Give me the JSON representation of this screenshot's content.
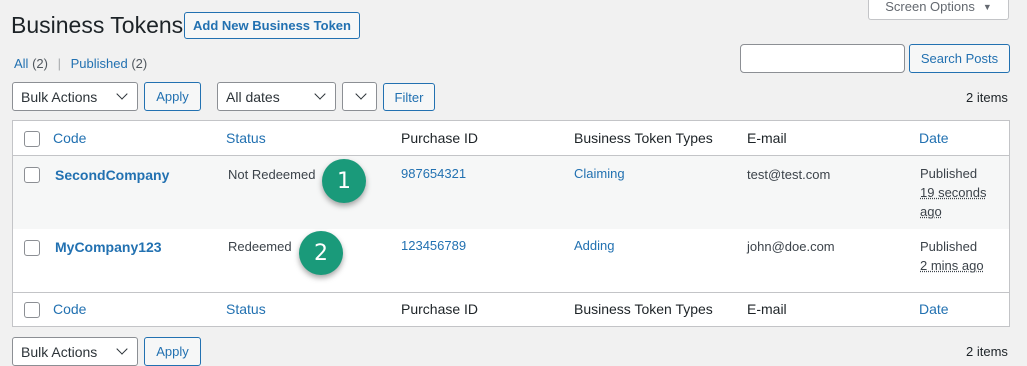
{
  "header": {
    "title": "Business Tokens",
    "add_new_label": "Add New Business Token",
    "screen_options_label": "Screen Options"
  },
  "filters": {
    "all_label": "All",
    "all_count": "(2)",
    "published_label": "Published",
    "published_count": "(2)"
  },
  "search": {
    "value": "",
    "button_label": "Search Posts"
  },
  "tablenav_top": {
    "bulk_actions": "Bulk Actions",
    "apply_label": "Apply",
    "dates": "All dates",
    "category": "",
    "filter_label": "Filter",
    "items": "2 items"
  },
  "tablenav_bottom": {
    "bulk_actions": "Bulk Actions",
    "apply_label": "Apply",
    "items": "2 items"
  },
  "columns": {
    "code": "Code",
    "status": "Status",
    "purchase_id": "Purchase ID",
    "types": "Business Token Types",
    "email": "E-mail",
    "date": "Date"
  },
  "rows": [
    {
      "code": "SecondCompany",
      "status": "Not Redeemed",
      "purchase_id": "987654321",
      "type": "Claiming",
      "email": "test@test.com",
      "date_status": "Published",
      "date_line1": "19 seconds",
      "date_line2": "ago",
      "badge": "1"
    },
    {
      "code": "MyCompany123",
      "status": "Redeemed",
      "purchase_id": "123456789",
      "type": "Adding",
      "email": "john@doe.com",
      "date_status": "Published",
      "date_line1": "2 mins ago",
      "date_line2": "",
      "badge": "2"
    }
  ],
  "colors": {
    "accent": "#2271b1",
    "badge": "#1a9a7a",
    "background": "#f1f1f1"
  }
}
